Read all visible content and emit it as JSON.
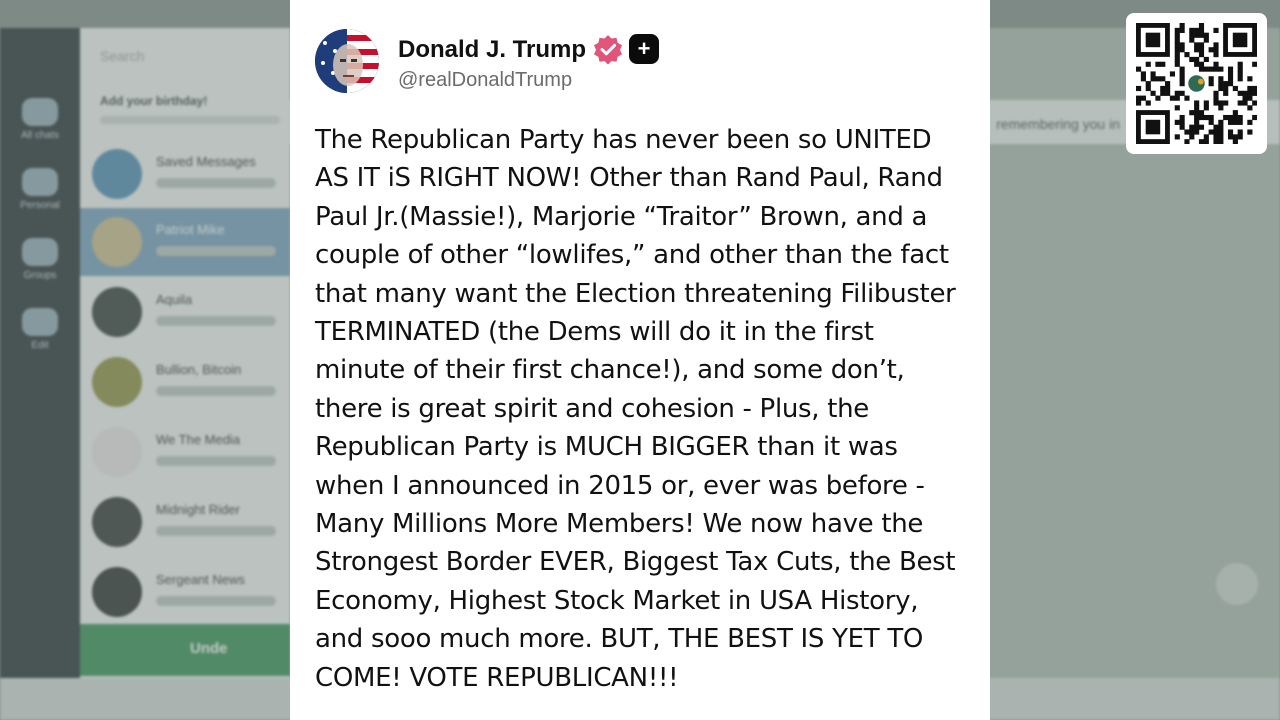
{
  "background_app": {
    "search_placeholder": "Search",
    "birthday_prompt": "Add your birthday!",
    "rail_items": [
      {
        "label": "All chats",
        "icon": "chat-bubbles-icon"
      },
      {
        "label": "Personal",
        "icon": "person-icon"
      },
      {
        "label": "Groups",
        "icon": "group-icon"
      },
      {
        "label": "Edit",
        "icon": "sliders-icon"
      }
    ],
    "chats": [
      {
        "name": "Saved Messages"
      },
      {
        "name": "Patriot Mike"
      },
      {
        "name": "Aquila"
      },
      {
        "name": "Bullion, Bitcoin"
      },
      {
        "name": "We The Media"
      },
      {
        "name": "Midnight Rider"
      },
      {
        "name": "Sergeant News"
      }
    ],
    "topbar_text": "remembering you in",
    "unread_label": "Unde"
  },
  "post": {
    "author_name": "Donald J. Trump",
    "handle": "@realDonaldTrump",
    "plus_badge": "+",
    "body": "The Republican Party has never been so UNITED\nAS IT iS RIGHT NOW! Other than Rand Paul, Rand\nPaul Jr.(Massie!), Marjorie “Traitor” Brown, and a\ncouple of other “lowlifes,” and other than the fact\nthat many want the Election threatening Filibuster\nTERMINATED (the Dems will do it in the first\nminute of their first chance!), and some don’t,\nthere is great spirit and cohesion - Plus, the\nRepublican Party is MUCH BIGGER than it was\nwhen I announced in 2015 or, ever was before -\nMany Millions More Members! We now have the\nStrongest Border EVER, Biggest Tax Cuts, the Best\nEconomy, Highest Stock Market in USA History,\nand sooo much more. BUT, THE BEST IS YET TO\nCOME! VOTE REPUBLICAN!!!"
  },
  "colors": {
    "verified": "#e0567a",
    "card_bg": "#ffffff",
    "text": "#111111",
    "handle": "#6b6b6b"
  }
}
